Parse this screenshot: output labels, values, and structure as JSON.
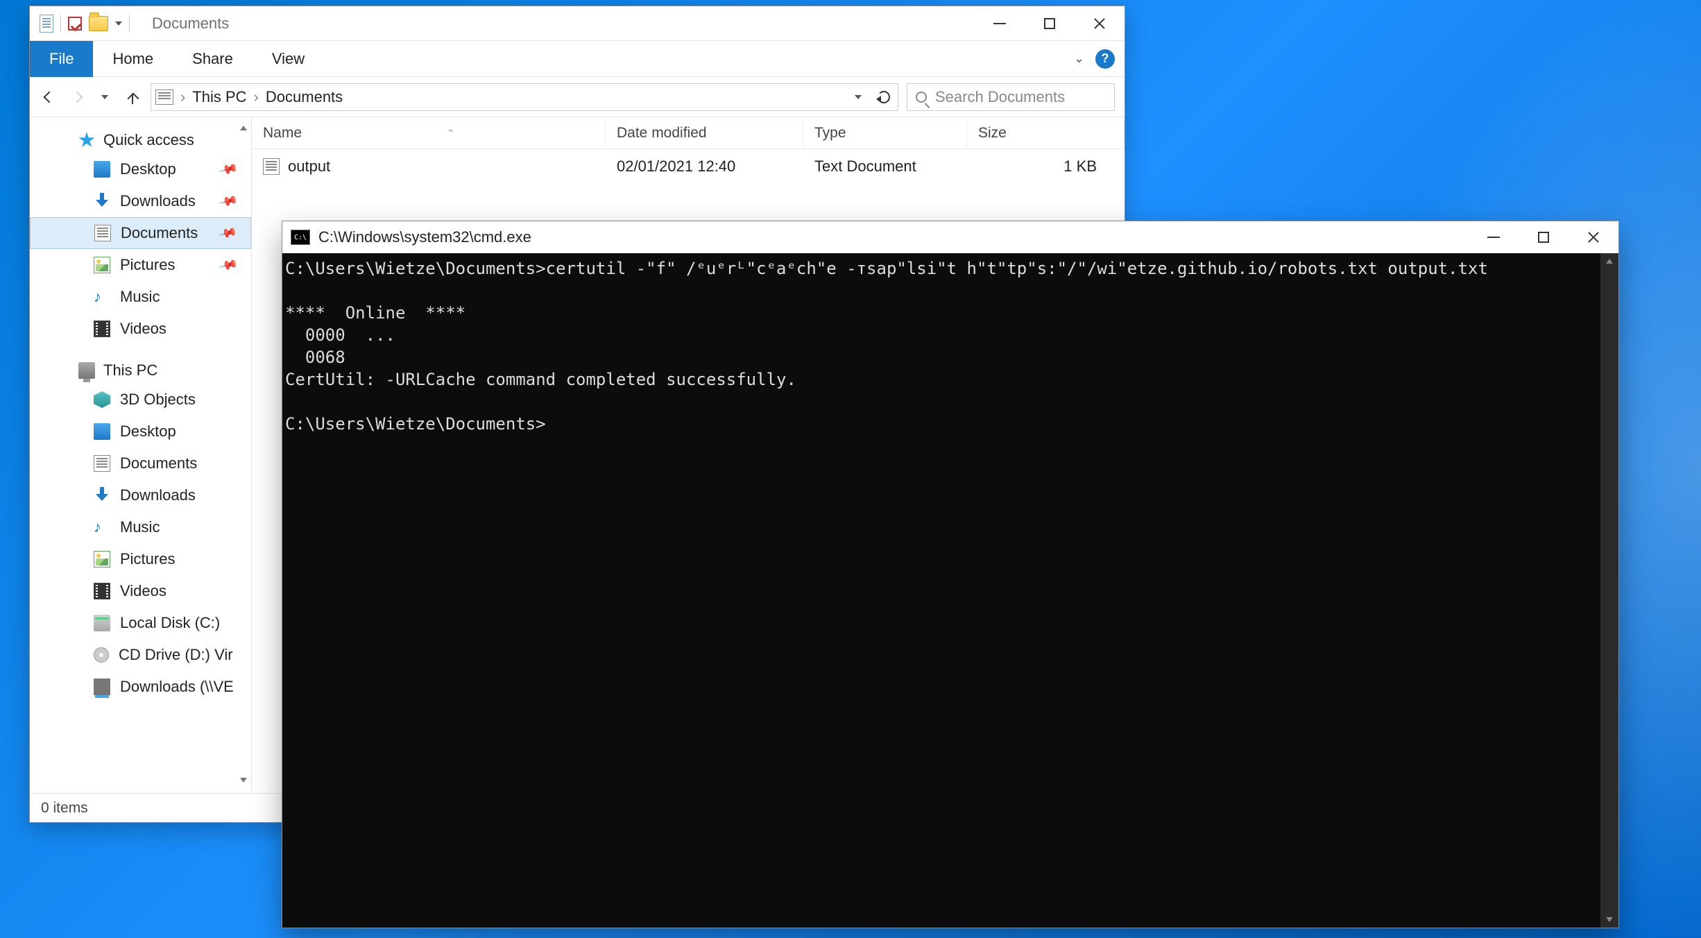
{
  "explorer": {
    "title": "Documents",
    "ribbon": {
      "file": "File",
      "tabs": [
        "Home",
        "Share",
        "View"
      ]
    },
    "breadcrumbs": [
      "This PC",
      "Documents"
    ],
    "search_placeholder": "Search Documents",
    "columns": {
      "name": "Name",
      "date": "Date modified",
      "type": "Type",
      "size": "Size"
    },
    "files": [
      {
        "name": "output",
        "date": "02/01/2021 12:40",
        "type": "Text Document",
        "size": "1 KB"
      }
    ],
    "status": "0 items",
    "sidebar": {
      "quick_access": {
        "label": "Quick access",
        "items": [
          {
            "label": "Desktop",
            "icon": "desktop",
            "pinned": true
          },
          {
            "label": "Downloads",
            "icon": "download",
            "pinned": true
          },
          {
            "label": "Documents",
            "icon": "doc",
            "pinned": true,
            "selected": true
          },
          {
            "label": "Pictures",
            "icon": "pic",
            "pinned": true
          },
          {
            "label": "Music",
            "icon": "music",
            "pinned": false
          },
          {
            "label": "Videos",
            "icon": "video",
            "pinned": false
          }
        ]
      },
      "this_pc": {
        "label": "This PC",
        "items": [
          {
            "label": "3D Objects",
            "icon": "3d"
          },
          {
            "label": "Desktop",
            "icon": "desktop"
          },
          {
            "label": "Documents",
            "icon": "doc"
          },
          {
            "label": "Downloads",
            "icon": "download"
          },
          {
            "label": "Music",
            "icon": "music"
          },
          {
            "label": "Pictures",
            "icon": "pic"
          },
          {
            "label": "Videos",
            "icon": "video"
          },
          {
            "label": "Local Disk (C:)",
            "icon": "disk"
          },
          {
            "label": "CD Drive (D:) Vir",
            "icon": "cd"
          },
          {
            "label": "Downloads (\\\\VE",
            "icon": "net"
          }
        ]
      }
    }
  },
  "cmd": {
    "title": "C:\\Windows\\system32\\cmd.exe",
    "icon_text": "C:\\",
    "lines": [
      "C:\\Users\\Wietze\\Documents>certutil -\"f\" /ᵉuᵉrᴸ\"cᵉaᵉch\"e -тsаp\"lѕi\"t h\"t\"tp\"s:\"/\"/wi\"etze.github.io/robots.txt output.txt",
      "",
      "****  Online  ****",
      "  0000  ...",
      "  0068",
      "CertUtil: -URLCache command completed successfully.",
      "",
      "C:\\Users\\Wietze\\Documents>"
    ]
  }
}
